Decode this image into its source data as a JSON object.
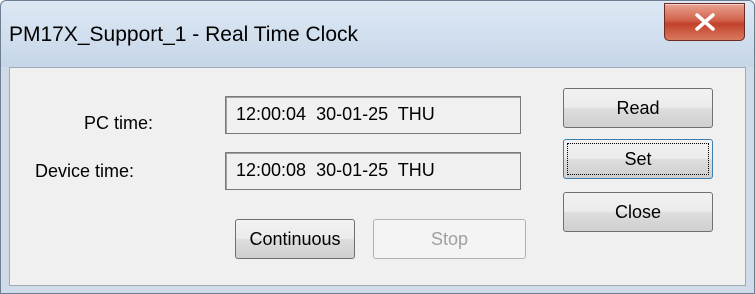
{
  "window": {
    "title": "PM17X_Support_1 - Real Time Clock",
    "close_icon": "close-x-icon"
  },
  "labels": {
    "pc_time": "PC time:",
    "device_time": "Device time:"
  },
  "fields": {
    "pc_time_value": "12:00:04  30-01-25  THU",
    "device_time_value": "12:00:08  30-01-25  THU"
  },
  "buttons": {
    "read": "Read",
    "set": "Set",
    "close": "Close",
    "continuous": "Continuous",
    "stop": "Stop"
  },
  "colors": {
    "close_button_red": "#c1422b",
    "titlebar": "#cfdbe9",
    "dialog_background": "#f0f0f0"
  }
}
